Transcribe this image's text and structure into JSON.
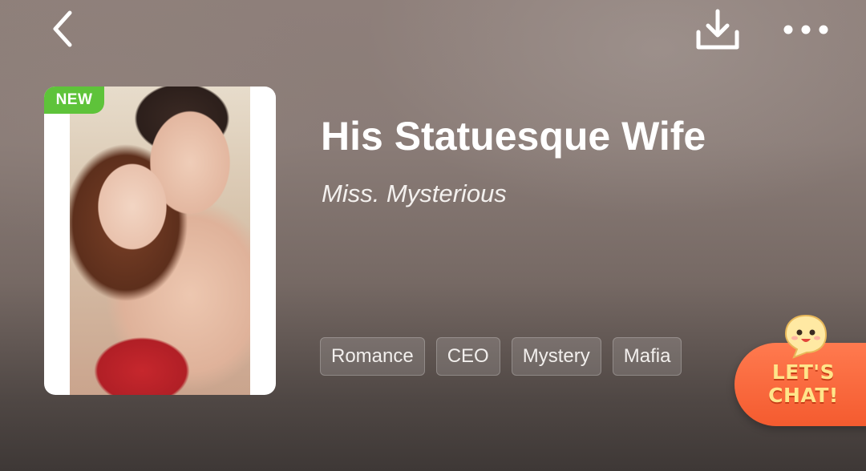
{
  "header": {
    "back_icon": "chevron-left-icon",
    "download_icon": "download-icon",
    "more_icon": "more-horizontal-icon"
  },
  "book": {
    "badge": "NEW",
    "title": "His Statuesque Wife",
    "author": "Miss. Mysterious",
    "tags": [
      "Romance",
      "CEO",
      "Mystery",
      "Mafia"
    ]
  },
  "chat_widget": {
    "line1": "LET'S",
    "line2": "CHAT!",
    "icon": "smiley-face-icon"
  },
  "colors": {
    "badge_green": "#5ec33a",
    "chat_orange": "#f45b2f",
    "chat_text": "#ffe58a"
  }
}
